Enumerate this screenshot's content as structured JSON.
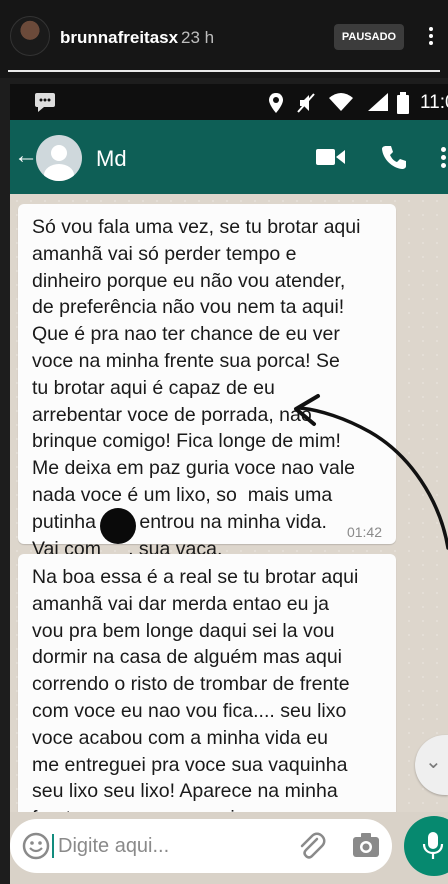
{
  "story": {
    "username": "brunnafreitasx",
    "time_ago": "23 h",
    "paused_label": "PAUSADO",
    "progress_fraction": 1.0
  },
  "status_bar": {
    "time": "11:0",
    "icons": [
      "message-icon",
      "location-icon",
      "mute-icon",
      "wifi-icon",
      "signal-icon",
      "battery-icon"
    ]
  },
  "chat_header": {
    "contact_name": "Md",
    "icons": [
      "back-arrow-icon",
      "video-call-icon",
      "phone-call-icon",
      "more-vert-icon"
    ]
  },
  "messages": [
    {
      "lines": [
        "Só vou fala uma vez, se tu brotar aqui",
        "amanhã vai só perder tempo e",
        "dinheiro porque eu não vou atender,",
        "de preferência não vou nem ta aqui!",
        "Que é pra nao ter chance de eu ver",
        "voce na minha frente sua porca! Se",
        "tu brotar aqui é capaz de eu",
        "arrebentar voce de porrada, nao",
        "brinque comigo! Fica longe de mim!",
        "Me deixa em paz guria voce nao vale",
        "nada voce é um lixo, so  mais uma",
        "putinha que entrou na minha vida.",
        "Vai com     , sua vaca."
      ],
      "time": "01:42"
    },
    {
      "lines": [
        "Na boa essa é a real se tu brotar aqui",
        "amanhã vai dar merda entao eu ja",
        "vou pra bem longe daqui sei la vou",
        "dormir na casa de alguém mas aqui",
        "correndo o risto de trombar de frente",
        "com voce eu nao vou fica.... seu lixo",
        "voce acabou com a minha vida eu",
        "me entreguei pra voce sua vaquinha",
        "seu lixo seu lixo! Aparece na minha",
        "frente que eu vou cuspir na sua cara"
      ]
    }
  ],
  "input_bar": {
    "placeholder": "Digite aqui..."
  },
  "colors": {
    "header_green": "#0e5f56",
    "accent_green": "#06896f",
    "chat_bg": "#ddd6cc",
    "bubble_bg": "#fcfcfc"
  }
}
